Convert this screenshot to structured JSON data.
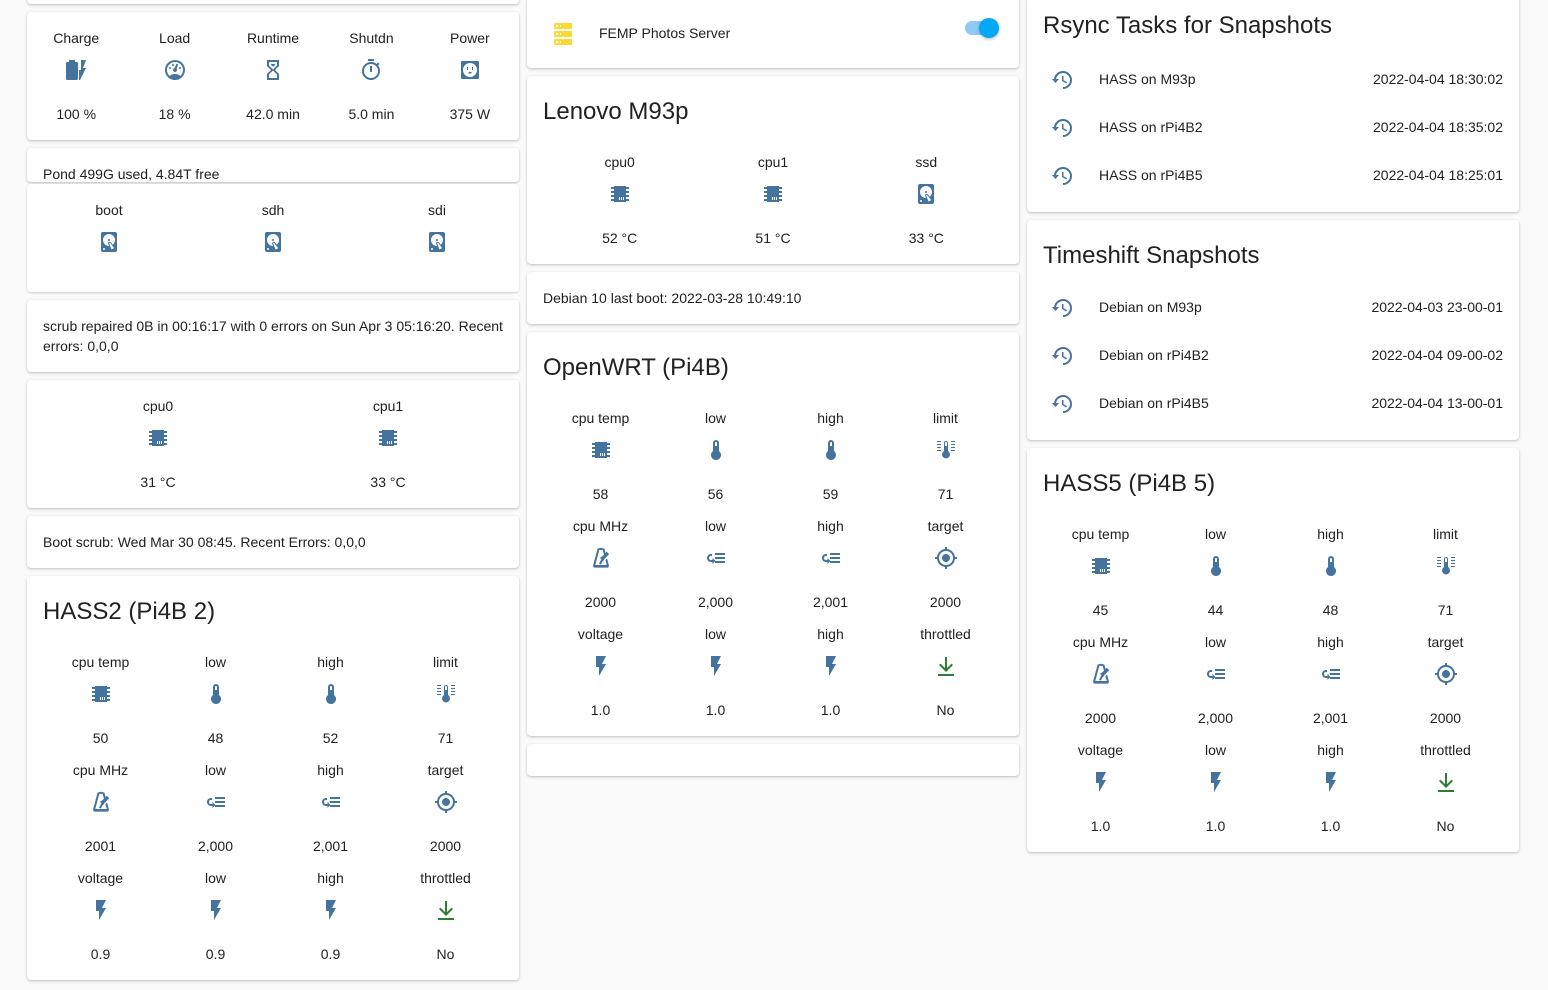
{
  "ups": {
    "items": [
      {
        "name": "Charge",
        "state": "100 %",
        "icon": "battery-charging-icon"
      },
      {
        "name": "Load",
        "state": "18 %",
        "icon": "gauge-icon"
      },
      {
        "name": "Runtime",
        "state": "42.0 min",
        "icon": "hourglass-icon"
      },
      {
        "name": "Shutdn",
        "state": "5.0 min",
        "icon": "timer-icon"
      },
      {
        "name": "Power",
        "state": "375 W",
        "icon": "power-socket-icon"
      }
    ]
  },
  "pond": {
    "header": "Pond   499G used, 4.84T free",
    "disks": [
      {
        "name": "boot",
        "icon": "harddisk-icon"
      },
      {
        "name": "sdh",
        "icon": "harddisk-icon"
      },
      {
        "name": "sdi",
        "icon": "harddisk-icon"
      }
    ]
  },
  "scrub_text": "scrub repaired 0B in 00:16:17 with 0 errors on Sun Apr 3 05:16:20. Recent errors: 0,0,0",
  "nas_cpu": {
    "items": [
      {
        "name": "cpu0",
        "state": "31 °C",
        "icon": "chip-icon"
      },
      {
        "name": "cpu1",
        "state": "33 °C",
        "icon": "chip-icon"
      }
    ]
  },
  "boot_scrub_text": "Boot scrub: Wed Mar 30 08:45. Recent Errors: 0,0,0",
  "hass2": {
    "title": "HASS2 (Pi4B 2)",
    "rows": [
      [
        {
          "name": "cpu temp",
          "state": "50",
          "icon": "chip-icon"
        },
        {
          "name": "low",
          "state": "48",
          "icon": "thermometer-icon"
        },
        {
          "name": "high",
          "state": "52",
          "icon": "thermometer-icon"
        },
        {
          "name": "limit",
          "state": "71",
          "icon": "thermometer-lines-icon"
        }
      ],
      [
        {
          "name": "cpu MHz",
          "state": "2001",
          "icon": "metronome-icon"
        },
        {
          "name": "low",
          "state": "2,000",
          "icon": "format-indent-icon"
        },
        {
          "name": "high",
          "state": "2,001",
          "icon": "format-indent-icon"
        },
        {
          "name": "target",
          "state": "2000",
          "icon": "crosshairs-icon"
        }
      ],
      [
        {
          "name": "voltage",
          "state": "0.9",
          "icon": "flash-icon"
        },
        {
          "name": "low",
          "state": "0.9",
          "icon": "flash-icon"
        },
        {
          "name": "high",
          "state": "0.9",
          "icon": "flash-icon"
        },
        {
          "name": "throttled",
          "state": "No",
          "icon": "download-arrow-icon"
        }
      ]
    ]
  },
  "femp": {
    "label": "FEMP Photos Server",
    "icon": "server-icon",
    "toggle": "on"
  },
  "m93p": {
    "title": "Lenovo M93p",
    "items": [
      {
        "name": "cpu0",
        "state": "52 °C",
        "icon": "chip-icon"
      },
      {
        "name": "cpu1",
        "state": "51 °C",
        "icon": "chip-icon"
      },
      {
        "name": "ssd",
        "state": "33 °C",
        "icon": "harddisk-icon"
      }
    ]
  },
  "debian_boot_text": "Debian 10 last boot: 2022-03-28 10:49:10",
  "openwrt": {
    "title": "OpenWRT (Pi4B)",
    "rows": [
      [
        {
          "name": "cpu temp",
          "state": "58",
          "icon": "chip-icon"
        },
        {
          "name": "low",
          "state": "56",
          "icon": "thermometer-icon"
        },
        {
          "name": "high",
          "state": "59",
          "icon": "thermometer-icon"
        },
        {
          "name": "limit",
          "state": "71",
          "icon": "thermometer-lines-icon"
        }
      ],
      [
        {
          "name": "cpu MHz",
          "state": "2000",
          "icon": "metronome-icon"
        },
        {
          "name": "low",
          "state": "2,000",
          "icon": "format-indent-icon"
        },
        {
          "name": "high",
          "state": "2,001",
          "icon": "format-indent-icon"
        },
        {
          "name": "target",
          "state": "2000",
          "icon": "crosshairs-icon"
        }
      ],
      [
        {
          "name": "voltage",
          "state": "1.0",
          "icon": "flash-icon"
        },
        {
          "name": "low",
          "state": "1.0",
          "icon": "flash-icon"
        },
        {
          "name": "high",
          "state": "1.0",
          "icon": "flash-icon"
        },
        {
          "name": "throttled",
          "state": "No",
          "icon": "download-arrow-icon"
        }
      ]
    ]
  },
  "rsync": {
    "title": "Rsync Tasks for Snapshots",
    "rows": [
      {
        "label": "HASS on M93p",
        "value": "2022-04-04 18:30:02",
        "icon": "restore-icon"
      },
      {
        "label": "HASS on rPi4B2",
        "value": "2022-04-04 18:35:02",
        "icon": "restore-icon"
      },
      {
        "label": "HASS on rPi4B5",
        "value": "2022-04-04 18:25:01",
        "icon": "restore-icon"
      }
    ]
  },
  "timeshift": {
    "title": "Timeshift Snapshots",
    "rows": [
      {
        "label": "Debian on M93p",
        "value": "2022-04-03 23-00-01",
        "icon": "restore-icon"
      },
      {
        "label": "Debian on rPi4B2",
        "value": "2022-04-04 09-00-02",
        "icon": "restore-icon"
      },
      {
        "label": "Debian on rPi4B5",
        "value": "2022-04-04 13-00-01",
        "icon": "restore-icon"
      }
    ]
  },
  "hass5": {
    "title": "HASS5 (Pi4B 5)",
    "rows": [
      [
        {
          "name": "cpu temp",
          "state": "45",
          "icon": "chip-icon"
        },
        {
          "name": "low",
          "state": "44",
          "icon": "thermometer-icon"
        },
        {
          "name": "high",
          "state": "48",
          "icon": "thermometer-icon"
        },
        {
          "name": "limit",
          "state": "71",
          "icon": "thermometer-lines-icon"
        }
      ],
      [
        {
          "name": "cpu MHz",
          "state": "2000",
          "icon": "metronome-icon"
        },
        {
          "name": "low",
          "state": "2,000",
          "icon": "format-indent-icon"
        },
        {
          "name": "high",
          "state": "2,001",
          "icon": "format-indent-icon"
        },
        {
          "name": "target",
          "state": "2000",
          "icon": "crosshairs-icon"
        }
      ],
      [
        {
          "name": "voltage",
          "state": "1.0",
          "icon": "flash-icon"
        },
        {
          "name": "low",
          "state": "1.0",
          "icon": "flash-icon"
        },
        {
          "name": "high",
          "state": "1.0",
          "icon": "flash-icon"
        },
        {
          "name": "throttled",
          "state": "No",
          "icon": "download-arrow-icon"
        }
      ]
    ]
  },
  "colors": {
    "icon": "#44739e",
    "green": "#2e7d32",
    "server": "#fdd835",
    "accent": "#03a9f4"
  }
}
